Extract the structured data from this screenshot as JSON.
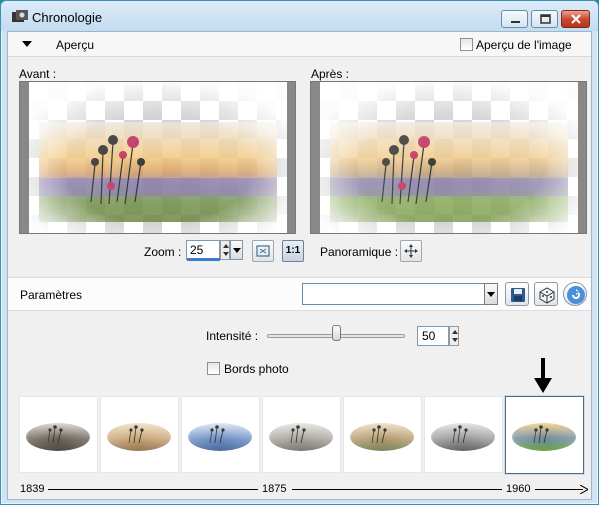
{
  "window": {
    "title": "Chronologie"
  },
  "toprow": {
    "apercu_label": "Aperçu",
    "image_preview_label": "Aperçu de l'image"
  },
  "preview": {
    "before_label": "Avant :",
    "after_label": "Après :"
  },
  "zoom": {
    "label": "Zoom :",
    "value": "25",
    "one_to_one": "1:1",
    "pan_label": "Panoramique :"
  },
  "params": {
    "label": "Paramètres",
    "preset_value": ""
  },
  "intensity": {
    "label": "Intensité :",
    "value": "50",
    "slider_fraction": 0.5
  },
  "bords": {
    "label": "Bords photo",
    "checked": false
  },
  "timeline": {
    "years": [
      "1839",
      "1875",
      "1960"
    ]
  },
  "thumbnails": [
    {
      "name": "sepia-dark",
      "selected": false
    },
    {
      "name": "sepia-light",
      "selected": false
    },
    {
      "name": "blue-tint",
      "selected": false
    },
    {
      "name": "grey-faded",
      "selected": false
    },
    {
      "name": "warm-faded",
      "selected": false
    },
    {
      "name": "greyscale",
      "selected": false
    },
    {
      "name": "color-1960",
      "selected": true
    }
  ],
  "colors": {
    "titlebar": "#c3dcf0",
    "close": "#c9452a",
    "accent": "#3a7bd5"
  }
}
